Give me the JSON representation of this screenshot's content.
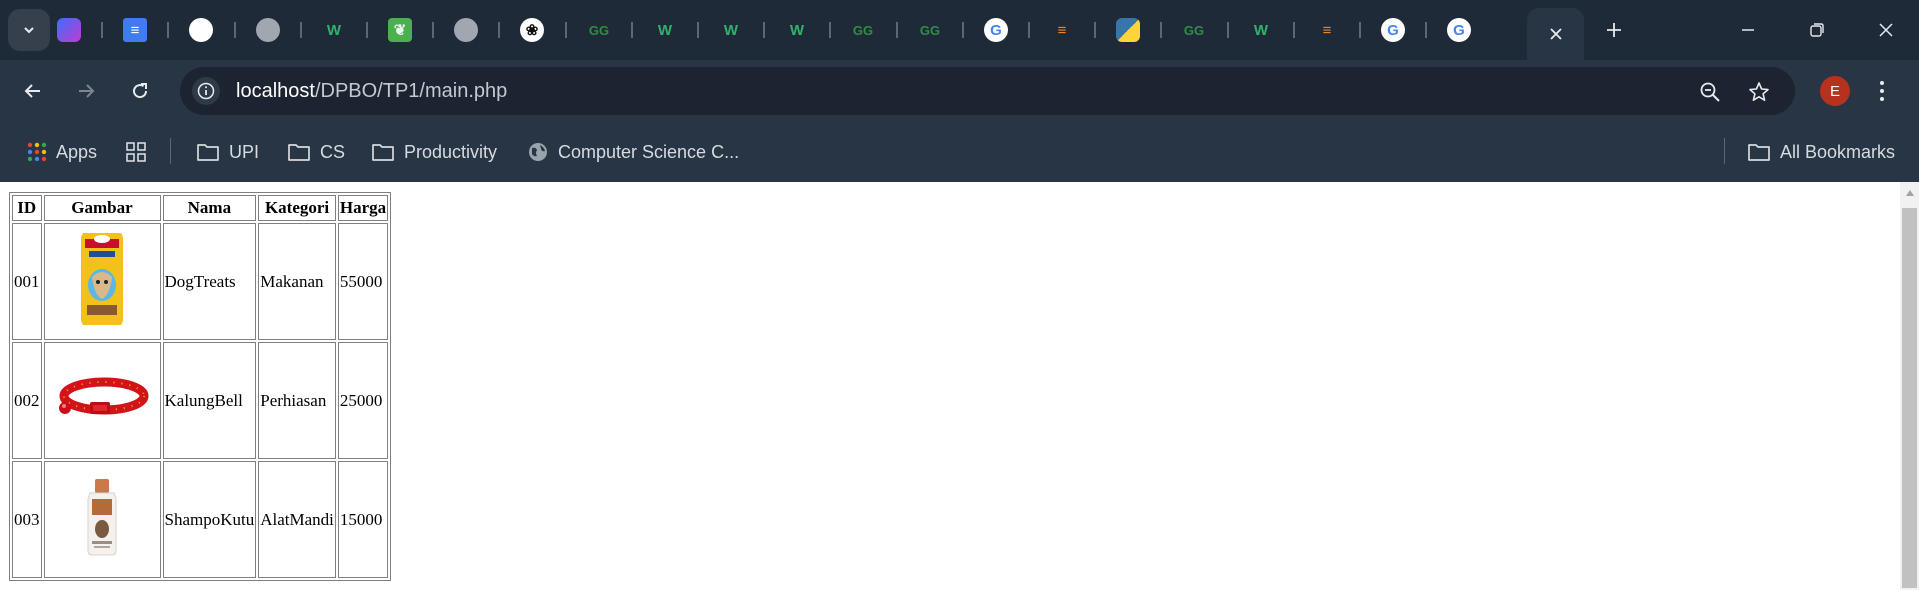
{
  "browser": {
    "url_host": "localhost",
    "url_path": "/DPBO/TP1/main.php",
    "profile_initial": "E",
    "bookmarks": {
      "apps": "Apps",
      "upi": "UPI",
      "cs": "CS",
      "productivity": "Productivity",
      "computer_science": "Computer Science C...",
      "all_bookmarks": "All Bookmarks"
    },
    "tab_icons": [
      "copilot-icon",
      "docs-icon",
      "github-icon",
      "globe-icon",
      "w3schools-icon",
      "leaf-icon",
      "globe-icon",
      "openai-icon",
      "geeksforgeeks-icon",
      "w3schools-icon",
      "w3schools-icon",
      "w3schools-icon",
      "geeksforgeeks-icon",
      "geeksforgeeks-icon",
      "google-icon",
      "stackoverflow-icon",
      "python-icon",
      "geeksforgeeks-icon",
      "w3schools-icon",
      "stackoverflow-icon",
      "google-icon",
      "google-icon"
    ]
  },
  "table": {
    "headers": {
      "id": "ID",
      "gambar": "Gambar",
      "nama": "Nama",
      "kategori": "Kategori",
      "harga": "Harga"
    },
    "rows": [
      {
        "id": "001",
        "image": "dog-treats-package-image",
        "nama": "DogTreats",
        "kategori": "Makanan",
        "harga": "55000"
      },
      {
        "id": "002",
        "image": "red-collar-bell-image",
        "nama": "KalungBell",
        "kategori": "Perhiasan",
        "harga": "25000"
      },
      {
        "id": "003",
        "image": "shampoo-bottle-image",
        "nama": "ShampoKutu",
        "kategori": "AlatMandi",
        "harga": "15000"
      }
    ]
  },
  "colors": {
    "tabstrip": "#1f2a38",
    "toolbar": "#283544",
    "omnibox": "#1b2430",
    "avatar": "#b5321f"
  }
}
